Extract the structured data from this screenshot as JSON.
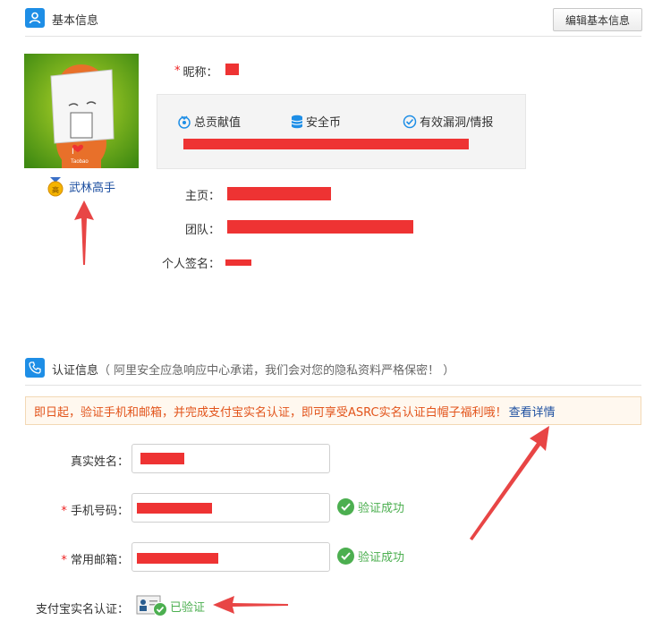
{
  "basic_info": {
    "title": "基本信息",
    "edit_button": "编辑基本信息",
    "badge_label": "武林高手",
    "nickname_label": "昵称：",
    "stats": [
      {
        "icon": "target-icon",
        "label": "总贡献值"
      },
      {
        "icon": "coins-icon",
        "label": "安全币"
      },
      {
        "icon": "check-circle-icon",
        "label": "有效漏洞/情报"
      }
    ],
    "homepage_label": "主页：",
    "team_label": "团队：",
    "signature_label": "个人签名："
  },
  "verification": {
    "title": "认证信息",
    "subtitle": "（ 阿里安全应急响应中心承诺，我们会对您的隐私资料严格保密！ ）",
    "notice_text": "即日起，验证手机和邮箱，并完成支付宝实名认证，即可享受ASRC实名认证白帽子福利哦！",
    "notice_link": "查看详情",
    "real_name_label": "真实姓名：",
    "phone_label": "手机号码：",
    "email_label": "常用邮箱：",
    "required_mark": "*",
    "verify_success": "验证成功",
    "alipay_label": "支付宝实名认证：",
    "alipay_status": "已验证"
  },
  "colors": {
    "accent": "#1e8ee6",
    "redaction": "#ee3333",
    "success": "#4caf50",
    "notice_text": "#e2541b",
    "arrow": "#e84545"
  }
}
